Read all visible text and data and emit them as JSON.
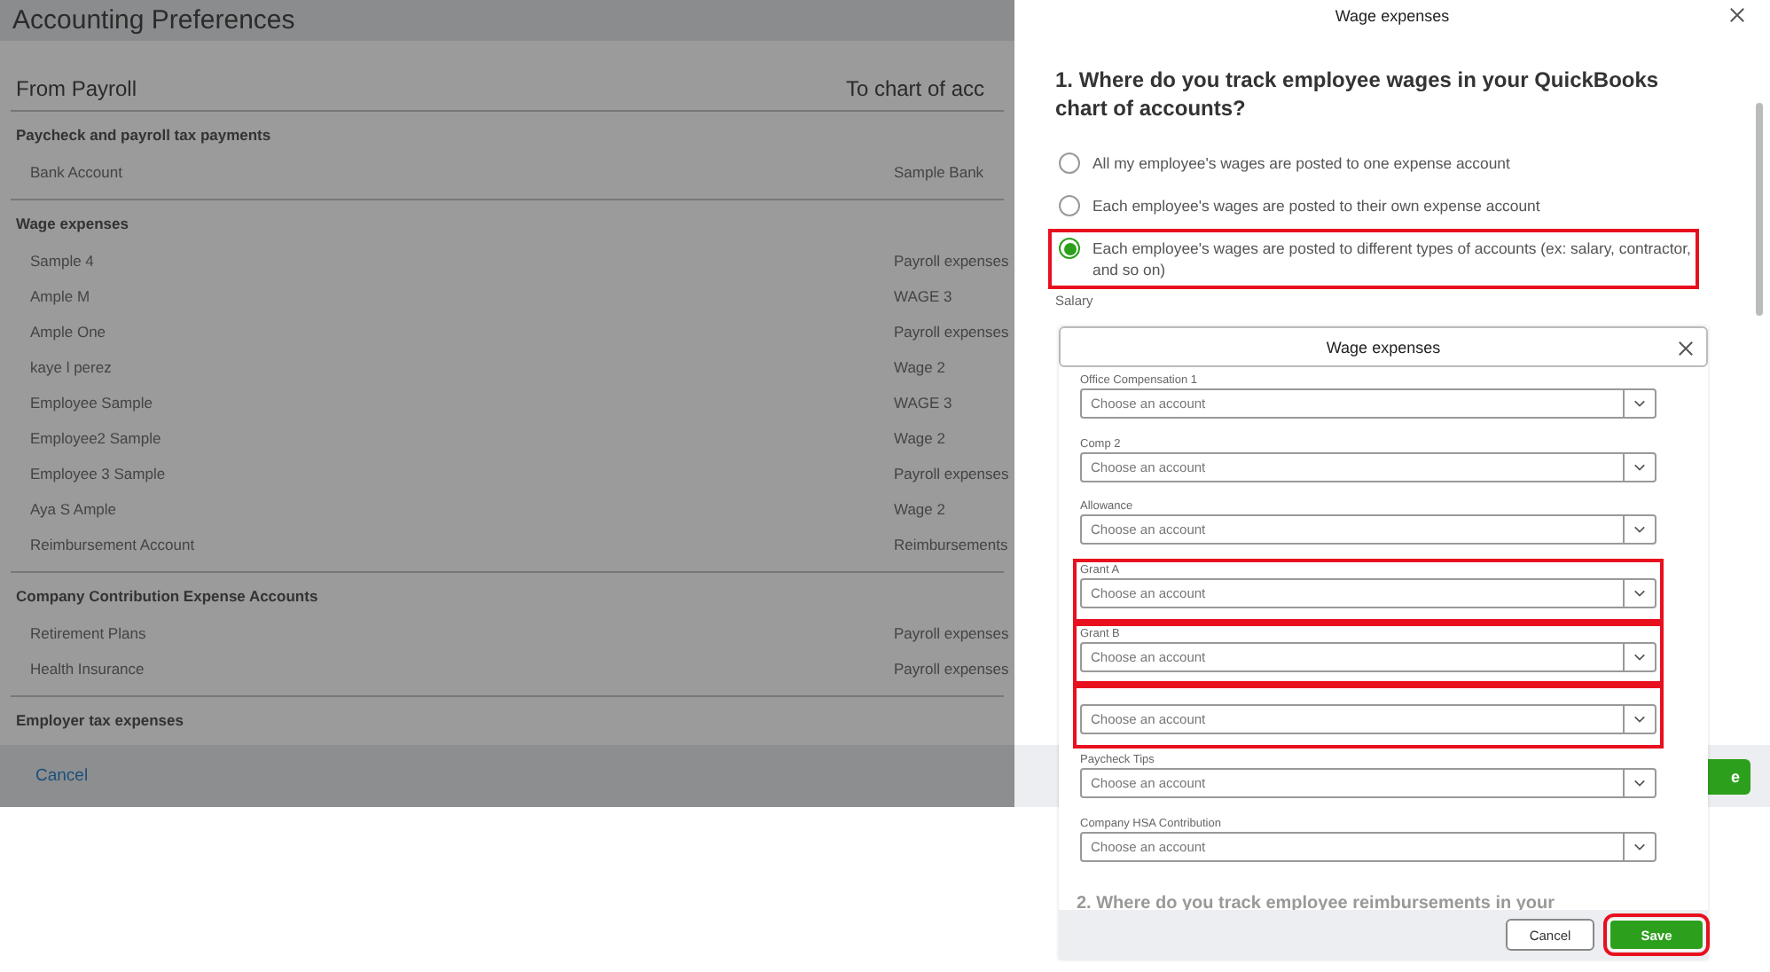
{
  "page": {
    "title": "Accounting Preferences",
    "columns": [
      "From Payroll",
      "To chart of acc"
    ],
    "sections": [
      {
        "title": "Paycheck and payroll tax payments",
        "rows": [
          {
            "name": "Bank Account",
            "account": "Sample Bank"
          }
        ]
      },
      {
        "title": "Wage expenses",
        "rows": [
          {
            "name": "Sample 4",
            "account": "Payroll expenses"
          },
          {
            "name": "Ample M",
            "account": "WAGE 3"
          },
          {
            "name": "Ample One",
            "account": "Payroll expenses"
          },
          {
            "name": "kaye l perez",
            "account": "Wage 2"
          },
          {
            "name": "Employee Sample",
            "account": "WAGE 3"
          },
          {
            "name": "Employee2 Sample",
            "account": "Wage 2"
          },
          {
            "name": "Employee 3 Sample",
            "account": "Payroll expenses"
          },
          {
            "name": "Aya S Ample",
            "account": "Wage 2"
          },
          {
            "name": "Reimbursement Account",
            "account": "Reimbursements"
          }
        ]
      },
      {
        "title": "Company Contribution Expense Accounts",
        "rows": [
          {
            "name": "Retirement Plans",
            "account": "Payroll expenses"
          },
          {
            "name": "Health Insurance",
            "account": "Payroll expenses"
          }
        ]
      },
      {
        "title": "Employer tax expenses"
      }
    ],
    "cancel": "Cancel"
  },
  "drawer": {
    "title": "Wage expenses",
    "question": "1. Where do you track employee wages in your QuickBooks chart of accounts?",
    "options": [
      {
        "label": "All my employee's wages are posted to one expense account",
        "selected": false,
        "highlighted": false
      },
      {
        "label": "Each employee's wages are posted to their own expense account",
        "selected": false,
        "highlighted": false
      },
      {
        "label": "Each employee's wages are posted to different types of accounts (ex: salary, contractor, and so on)",
        "selected": true,
        "highlighted": true
      }
    ],
    "salary_label": "Salary",
    "save_fragment": "e"
  },
  "popup": {
    "title": "Wage expenses",
    "fields": [
      {
        "label": "Office Compensation 1",
        "placeholder": "Choose an account",
        "highlighted": false
      },
      {
        "label": "Comp 2",
        "placeholder": "Choose an account",
        "highlighted": false
      },
      {
        "label": "Allowance",
        "placeholder": "Choose an account",
        "highlighted": false
      },
      {
        "label": "Grant A",
        "placeholder": "Choose an account",
        "highlighted": true
      },
      {
        "label": "Grant B",
        "placeholder": "Choose an account",
        "highlighted": true
      },
      {
        "placeholder": "Choose an account",
        "highlighted": true
      },
      {
        "label": "Paycheck Tips",
        "placeholder": "Choose an account",
        "highlighted": false
      },
      {
        "label": "Company HSA Contribution",
        "placeholder": "Choose an account",
        "highlighted": false
      }
    ],
    "next_question": "2. Where do you track employee reimbursements in your",
    "buttons": [
      {
        "label": "Cancel",
        "kind": "secondary",
        "highlighted": false
      },
      {
        "label": "Save",
        "kind": "primary",
        "highlighted": true
      }
    ]
  }
}
